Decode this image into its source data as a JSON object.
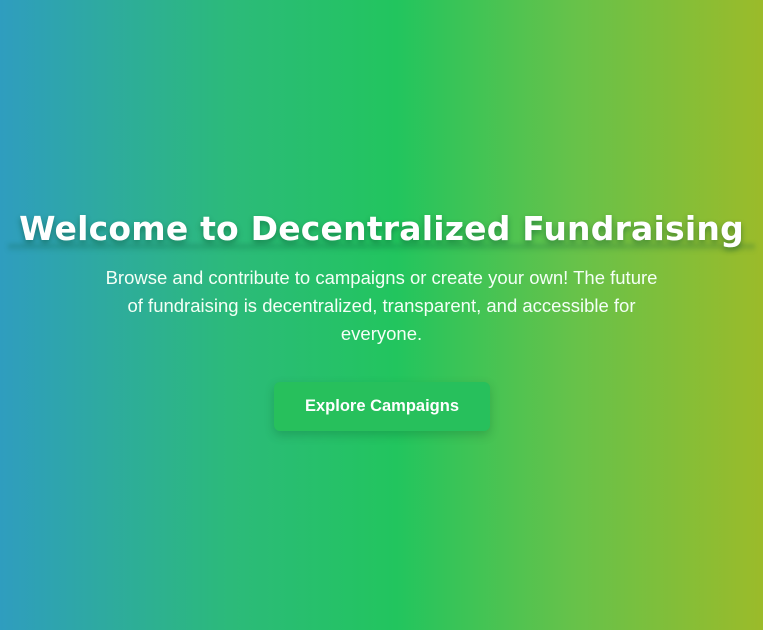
{
  "hero": {
    "title": "Welcome to Decentralized Fundraising",
    "subtitle": "Browse and contribute to campaigns or create your own! The future of fundraising is decentralized, transparent, and accessible for everyone.",
    "cta_label": "Explore Campaigns"
  },
  "colors": {
    "gradient_left": "#2f9dbf",
    "gradient_middle": "#22c55e",
    "gradient_right": "#9bbb2a",
    "button_background": "#27c05c",
    "text": "#ffffff"
  }
}
